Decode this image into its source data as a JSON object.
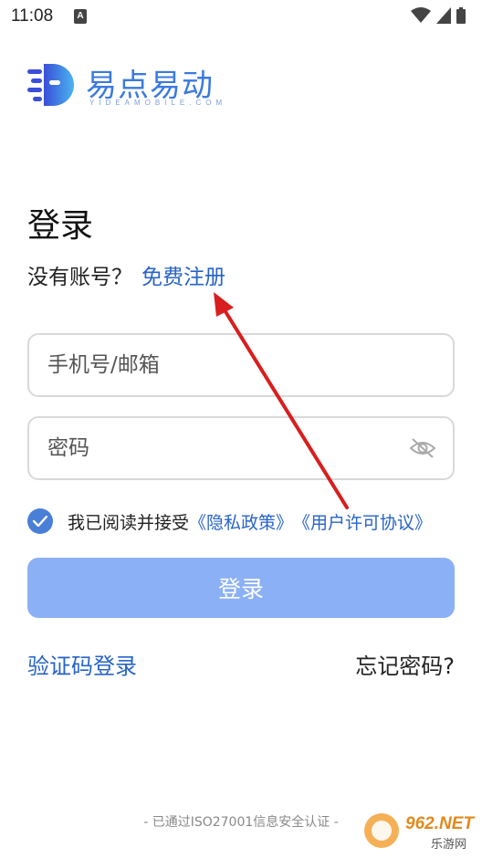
{
  "status_bar": {
    "time": "11:08",
    "notification_icon": "a-icon",
    "wifi_icon": "wifi-icon",
    "signal_icon": "signal-icon",
    "battery_icon": "battery-icon"
  },
  "brand": {
    "logo_icon": "app-logo-icon",
    "name": "易点易动",
    "domain": "YIDEAMOBILE.COM",
    "color": "#3b79e0"
  },
  "page": {
    "title": "登录",
    "register_prompt": "没有账号？",
    "register_link": "免费注册"
  },
  "form": {
    "phone_placeholder": "手机号/邮箱",
    "phone_value": "",
    "password_placeholder": "密码",
    "password_value": "",
    "password_visibility_icon": "eye-off-icon",
    "agree_checked": true,
    "agree_text": "我已阅读并接受",
    "privacy_policy": "《隐私政策》",
    "user_agreement": "《用户许可协议》",
    "login_button": "登录"
  },
  "links": {
    "code_login": "验证码登录",
    "forgot_password": "忘记密码?"
  },
  "footer": {
    "certification": "- 已通过ISO27001信息安全认证 -"
  },
  "watermark": {
    "brand": "962.NET",
    "subtitle": "乐游网"
  },
  "annotation": {
    "arrow_icon": "red-arrow-icon"
  },
  "colors": {
    "link": "#2763c8",
    "button": "#8bb0f5",
    "checkbox": "#4a7fd8",
    "arrow": "#d81e1e"
  }
}
